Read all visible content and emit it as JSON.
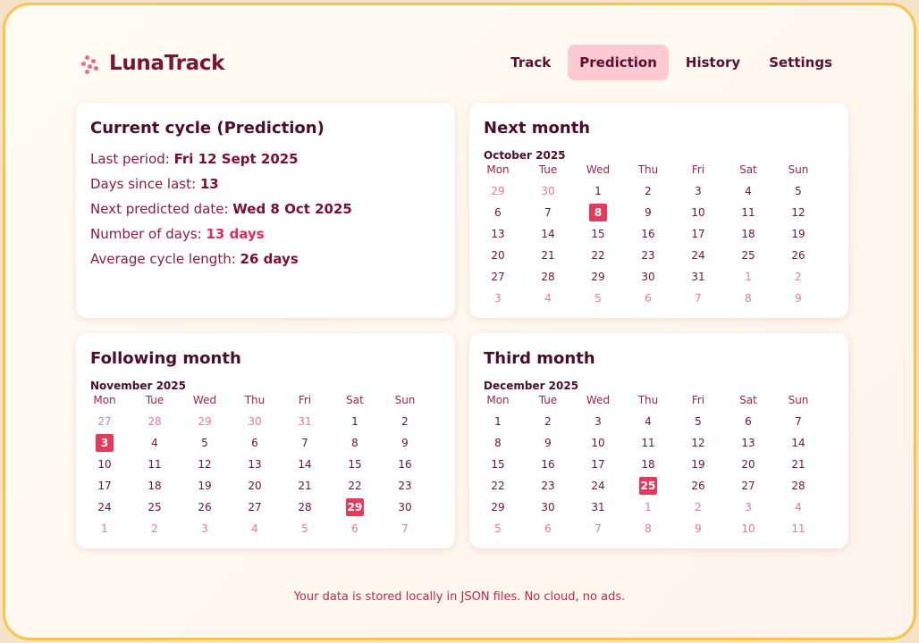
{
  "app": {
    "name": "LunaTrack",
    "icon": "sparkle-dots-icon",
    "colors": {
      "accent": "#e63a5c",
      "nav_active_bg": "#fdc9d3",
      "brand_text": "#7a1436",
      "window_border": "#fcc34a"
    }
  },
  "nav": [
    {
      "label": "Track",
      "active": false
    },
    {
      "label": "Prediction",
      "active": true
    },
    {
      "label": "History",
      "active": false
    },
    {
      "label": "Settings",
      "active": false
    }
  ],
  "current_cycle": {
    "title": "Current cycle (Prediction)",
    "rows": [
      {
        "label": "Last period: ",
        "value": "Fri 12 Sept 2025",
        "emphasis": "dark"
      },
      {
        "label": "Days since last: ",
        "value": "13",
        "emphasis": "dark"
      },
      {
        "label": "Next predicted date: ",
        "value": "Wed 8 Oct 2025",
        "emphasis": "dark"
      },
      {
        "label": "Number of days: ",
        "value": "13 days",
        "emphasis": "pink"
      },
      {
        "label": "Average cycle length: ",
        "value": "26 days",
        "emphasis": "dark"
      }
    ]
  },
  "weekdays": [
    "Mon",
    "Tue",
    "Wed",
    "Thu",
    "Fri",
    "Sat",
    "Sun"
  ],
  "calendars": [
    {
      "title": "Next month",
      "month": "October 2025",
      "days": [
        {
          "d": "29",
          "o": true
        },
        {
          "d": "30",
          "o": true
        },
        {
          "d": "1"
        },
        {
          "d": "2"
        },
        {
          "d": "3"
        },
        {
          "d": "4"
        },
        {
          "d": "5"
        },
        {
          "d": "6"
        },
        {
          "d": "7"
        },
        {
          "d": "8",
          "h": true
        },
        {
          "d": "9"
        },
        {
          "d": "10"
        },
        {
          "d": "11"
        },
        {
          "d": "12"
        },
        {
          "d": "13"
        },
        {
          "d": "14"
        },
        {
          "d": "15"
        },
        {
          "d": "16"
        },
        {
          "d": "17"
        },
        {
          "d": "18"
        },
        {
          "d": "19"
        },
        {
          "d": "20"
        },
        {
          "d": "21"
        },
        {
          "d": "22"
        },
        {
          "d": "23"
        },
        {
          "d": "24"
        },
        {
          "d": "25"
        },
        {
          "d": "26"
        },
        {
          "d": "27"
        },
        {
          "d": "28"
        },
        {
          "d": "29"
        },
        {
          "d": "30"
        },
        {
          "d": "31"
        },
        {
          "d": "1",
          "o": true
        },
        {
          "d": "2",
          "o": true
        },
        {
          "d": "3",
          "o": true
        },
        {
          "d": "4",
          "o": true
        },
        {
          "d": "5",
          "o": true
        },
        {
          "d": "6",
          "o": true
        },
        {
          "d": "7",
          "o": true
        },
        {
          "d": "8",
          "o": true
        },
        {
          "d": "9",
          "o": true
        }
      ]
    },
    {
      "title": "Following month",
      "month": "November 2025",
      "days": [
        {
          "d": "27",
          "o": true
        },
        {
          "d": "28",
          "o": true
        },
        {
          "d": "29",
          "o": true
        },
        {
          "d": "30",
          "o": true
        },
        {
          "d": "31",
          "o": true
        },
        {
          "d": "1"
        },
        {
          "d": "2"
        },
        {
          "d": "3",
          "h": true
        },
        {
          "d": "4"
        },
        {
          "d": "5"
        },
        {
          "d": "6"
        },
        {
          "d": "7"
        },
        {
          "d": "8"
        },
        {
          "d": "9"
        },
        {
          "d": "10"
        },
        {
          "d": "11"
        },
        {
          "d": "12"
        },
        {
          "d": "13"
        },
        {
          "d": "14"
        },
        {
          "d": "15"
        },
        {
          "d": "16"
        },
        {
          "d": "17"
        },
        {
          "d": "18"
        },
        {
          "d": "19"
        },
        {
          "d": "20"
        },
        {
          "d": "21"
        },
        {
          "d": "22"
        },
        {
          "d": "23"
        },
        {
          "d": "24"
        },
        {
          "d": "25"
        },
        {
          "d": "26"
        },
        {
          "d": "27"
        },
        {
          "d": "28"
        },
        {
          "d": "29",
          "h": true
        },
        {
          "d": "30"
        },
        {
          "d": "1",
          "o": true
        },
        {
          "d": "2",
          "o": true
        },
        {
          "d": "3",
          "o": true
        },
        {
          "d": "4",
          "o": true
        },
        {
          "d": "5",
          "o": true
        },
        {
          "d": "6",
          "o": true
        },
        {
          "d": "7",
          "o": true
        }
      ]
    },
    {
      "title": "Third month",
      "month": "December 2025",
      "days": [
        {
          "d": "1"
        },
        {
          "d": "2"
        },
        {
          "d": "3"
        },
        {
          "d": "4"
        },
        {
          "d": "5"
        },
        {
          "d": "6"
        },
        {
          "d": "7"
        },
        {
          "d": "8"
        },
        {
          "d": "9"
        },
        {
          "d": "10"
        },
        {
          "d": "11"
        },
        {
          "d": "12"
        },
        {
          "d": "13"
        },
        {
          "d": "14"
        },
        {
          "d": "15"
        },
        {
          "d": "16"
        },
        {
          "d": "17"
        },
        {
          "d": "18"
        },
        {
          "d": "19"
        },
        {
          "d": "20"
        },
        {
          "d": "21"
        },
        {
          "d": "22"
        },
        {
          "d": "23"
        },
        {
          "d": "24"
        },
        {
          "d": "25",
          "h": true
        },
        {
          "d": "26"
        },
        {
          "d": "27"
        },
        {
          "d": "28"
        },
        {
          "d": "29"
        },
        {
          "d": "30"
        },
        {
          "d": "31"
        },
        {
          "d": "1",
          "o": true
        },
        {
          "d": "2",
          "o": true
        },
        {
          "d": "3",
          "o": true
        },
        {
          "d": "4",
          "o": true
        },
        {
          "d": "5",
          "o": true
        },
        {
          "d": "6",
          "o": true
        },
        {
          "d": "7",
          "o": true
        },
        {
          "d": "8",
          "o": true
        },
        {
          "d": "9",
          "o": true
        },
        {
          "d": "10",
          "o": true
        },
        {
          "d": "11",
          "o": true
        }
      ]
    }
  ],
  "footer": "Your data is stored locally in JSON files. No cloud, no ads."
}
